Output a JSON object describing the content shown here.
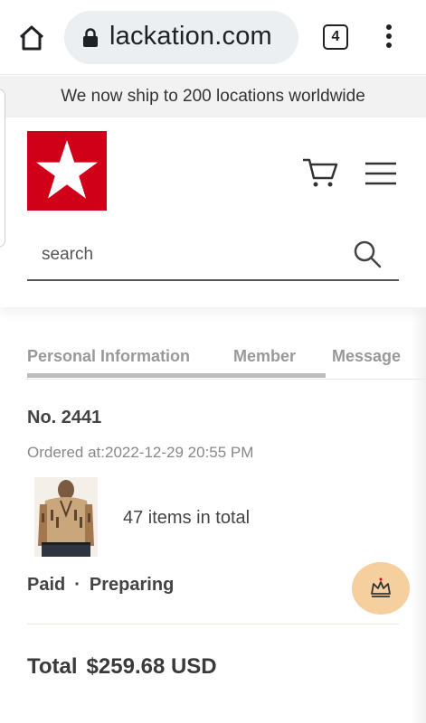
{
  "browser": {
    "url": "lackation.com",
    "tab_count": "4"
  },
  "announcement": "We now ship to 200 locations worldwide",
  "header": {
    "search_placeholder": "search"
  },
  "tabs": [
    {
      "label": "Personal Information",
      "active": true
    },
    {
      "label": "Member",
      "active": false
    },
    {
      "label": "Message",
      "active": false
    }
  ],
  "order": {
    "number": "No. 2441",
    "ordered_at": "Ordered at:2022-12-29 20:55 PM",
    "items_total": "47 items in total",
    "payment_status": "Paid",
    "separator": "·",
    "fulfillment_status": "Preparing",
    "total_label": "Total",
    "total_amount": "$259.68 USD"
  },
  "colors": {
    "logo_red": "#d00019",
    "vip_button": "#f6cf9e",
    "tab_inactive": "#999999",
    "text_dark": "#444444"
  },
  "icons": {
    "home": "home-icon",
    "lock": "lock-icon",
    "tabs": "tab-switcher-icon",
    "menu": "more-vert-icon",
    "logo": "star-logo",
    "cart": "cart-icon",
    "hamburger": "hamburger-menu-icon",
    "search": "search-icon",
    "vip": "crown-icon"
  }
}
